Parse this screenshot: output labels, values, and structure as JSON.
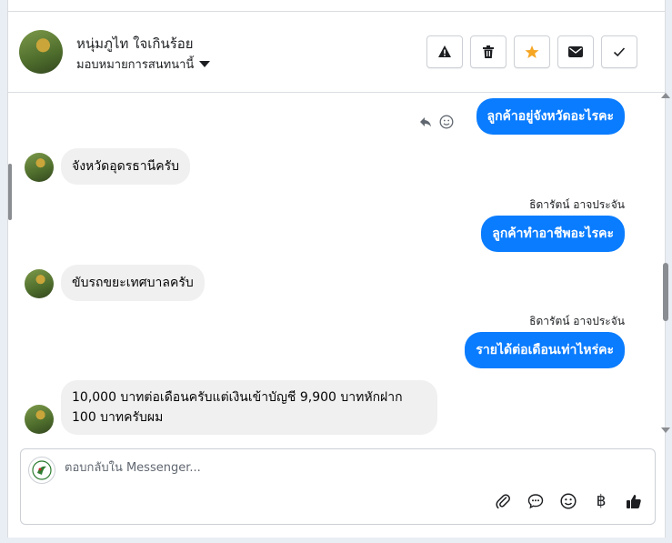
{
  "header": {
    "contact_name": "หนุ่มภูไท ใจเกินร้อย",
    "assign_label": "มอบหมายการสนทนานี้",
    "tools": [
      "warning-icon",
      "trash-icon",
      "star-icon",
      "envelope-icon",
      "check-icon"
    ]
  },
  "thread": {
    "messages": [
      {
        "dir": "out",
        "text": "ลูกค้าอยู่จังหวัดอะไรคะ"
      },
      {
        "dir": "in",
        "text": "จังหวัดอุดรธานีครับ"
      },
      {
        "dir": "out",
        "sender": "ธิดารัตน์ อาจประจัน",
        "text": "ลูกค้าทำอาชีพอะไรคะ"
      },
      {
        "dir": "in",
        "text": "ขับรถขยะเทศบาลครับ"
      },
      {
        "dir": "out",
        "sender": "ธิดารัตน์ อาจประจัน",
        "text": "รายได้ต่อเดือนเท่าไหร่คะ"
      },
      {
        "dir": "in",
        "text": "10,000 บาทต่อเดือนครับแต่เงินเข้าบัญชี 9,900 บาทหักฝาก 100 บาทครับผม"
      }
    ]
  },
  "composer": {
    "placeholder": "ตอบกลับใน Messenger...",
    "icons": [
      "paperclip-icon",
      "speech-bubble-icon",
      "emoji-icon",
      "baht-icon",
      "thumbs-up-icon"
    ],
    "baht_glyph": "฿"
  },
  "colors": {
    "outgoing_bubble": "#0a7cff",
    "incoming_bubble": "#f0f0f0",
    "star": "#f5a623"
  }
}
